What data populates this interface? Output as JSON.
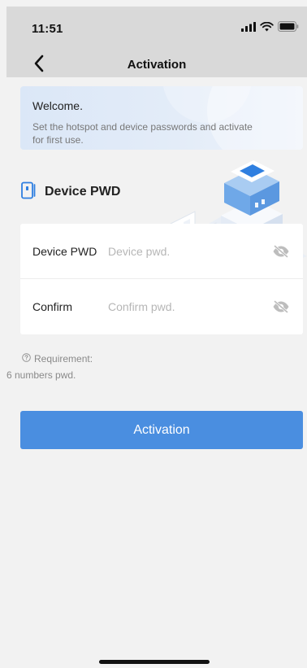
{
  "status_bar": {
    "time": "11:51",
    "icons": [
      "signal-icon",
      "wifi-icon",
      "battery-icon"
    ]
  },
  "nav": {
    "back_icon": "chevron-left-icon",
    "title": "Activation"
  },
  "welcome": {
    "title": "Welcome.",
    "description": "Set the hotspot and device passwords and activate for first use."
  },
  "device_section": {
    "icon": "device-icon",
    "title": "Device PWD"
  },
  "form": {
    "fields": [
      {
        "label": "Device PWD",
        "placeholder": "Device pwd.",
        "value": "",
        "toggle_icon": "eye-off-icon"
      },
      {
        "label": "Confirm",
        "placeholder": "Confirm pwd.",
        "value": "",
        "toggle_icon": "eye-off-icon"
      }
    ]
  },
  "requirement": {
    "icon": "help-circle-icon",
    "label": "Requirement:",
    "text": "6 numbers pwd."
  },
  "actions": {
    "activate_label": "Activation"
  },
  "colors": {
    "primary": "#4a8ee0",
    "background": "#f2f2f2",
    "header": "#d9d9d9"
  }
}
